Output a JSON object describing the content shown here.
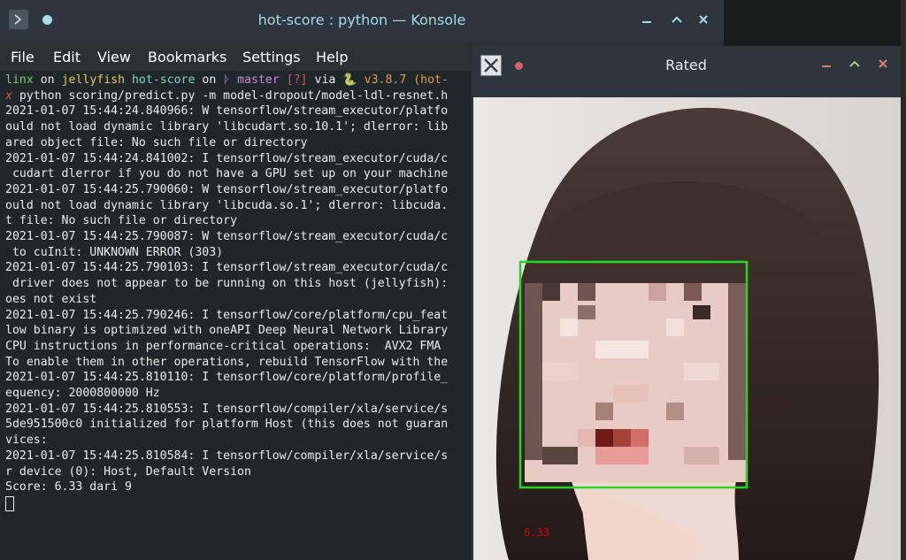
{
  "konsole": {
    "title": "hot-score : python — Konsole",
    "menu": [
      "File",
      "Edit",
      "View",
      "Bookmarks",
      "Settings",
      "Help"
    ],
    "prompt": {
      "user": "linx",
      "on1": "on",
      "host": "jellyfish",
      "dir": "hot-score",
      "on2": "on",
      "branch_icon": "ᚦ",
      "branch": "master",
      "status": "[?]",
      "via": "via",
      "python_icon": "🐍",
      "env": "v3.8.7 (hot-"
    },
    "command_marker": "x",
    "command": " python scoring/predict.py -m model-dropout/model-ldl-resnet.h",
    "lines": [
      "2021-01-07 15:44:24.840966: W tensorflow/stream_executor/platfo",
      "ould not load dynamic library 'libcudart.so.10.1'; dlerror: lib",
      "ared object file: No such file or directory",
      "2021-01-07 15:44:24.841002: I tensorflow/stream_executor/cuda/c",
      " cudart dlerror if you do not have a GPU set up on your machine",
      "2021-01-07 15:44:25.790060: W tensorflow/stream_executor/platfo",
      "ould not load dynamic library 'libcuda.so.1'; dlerror: libcuda.",
      "t file: No such file or directory",
      "2021-01-07 15:44:25.790087: W tensorflow/stream_executor/cuda/c",
      " to cuInit: UNKNOWN ERROR (303)",
      "2021-01-07 15:44:25.790103: I tensorflow/stream_executor/cuda/c",
      " driver does not appear to be running on this host (jellyfish):",
      "oes not exist",
      "2021-01-07 15:44:25.790246: I tensorflow/core/platform/cpu_feat",
      "low binary is optimized with oneAPI Deep Neural Network Library",
      "CPU instructions in performance-critical operations:  AVX2 FMA",
      "To enable them in other operations, rebuild TensorFlow with the",
      "2021-01-07 15:44:25.810110: I tensorflow/core/platform/profile_",
      "equency: 2000800000 Hz",
      "2021-01-07 15:44:25.810553: I tensorflow/compiler/xla/service/s",
      "5de951500c0 initialized for platform Host (this does not guaran",
      "vices:",
      "2021-01-07 15:44:25.810584: I tensorflow/compiler/xla/service/s",
      "r device (0): Host, Default Version",
      "Score: 6.33 dari 9"
    ]
  },
  "rated": {
    "title": "Rated",
    "score_label": "6.33"
  },
  "colors": {
    "box": "#22d822",
    "score": "#e00000",
    "accent": "#a8d8ea"
  },
  "icons": [
    "terminal-app-icon",
    "pin-icon",
    "minimize-icon",
    "maximize-icon",
    "close-icon",
    "x-app-icon"
  ]
}
